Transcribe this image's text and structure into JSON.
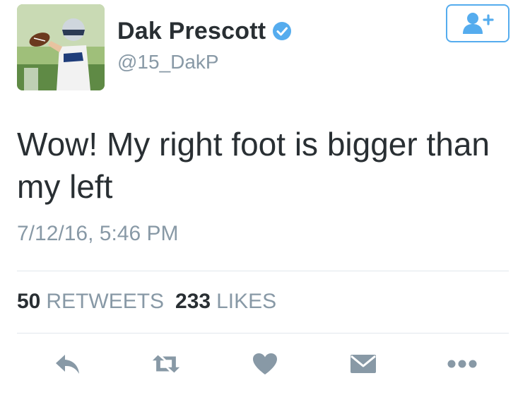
{
  "profile": {
    "display_name": "Dak Prescott",
    "handle": "@15_DakP",
    "verified": true
  },
  "tweet": {
    "text": "Wow! My right foot is bigger than my left",
    "timestamp": "7/12/16, 5:46 PM"
  },
  "stats": {
    "retweets_count": "50",
    "retweets_label": "RETWEETS",
    "likes_count": "233",
    "likes_label": "LIKES"
  },
  "actions": [
    "reply-icon",
    "retweet-icon",
    "like-icon",
    "direct-message-icon",
    "more-icon"
  ],
  "colors": {
    "text": "#292f33",
    "secondary": "#8899a6",
    "accent": "#55acee",
    "action_icon": "#8899a6",
    "divider": "#e1e8ed"
  }
}
